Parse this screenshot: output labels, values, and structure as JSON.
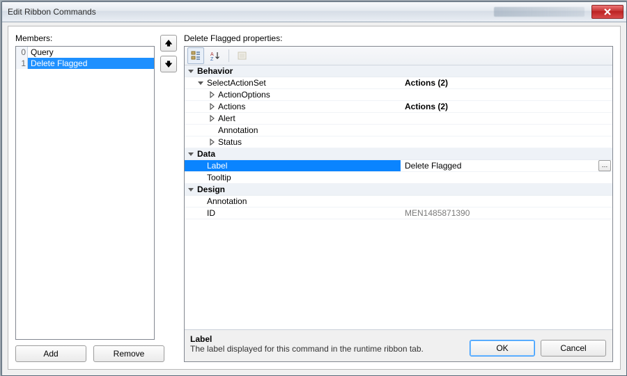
{
  "window": {
    "title": "Edit Ribbon Commands"
  },
  "colors": {
    "select": "#1e90ff",
    "prop_select": "#0a84ff"
  },
  "members": {
    "label": "Members:",
    "items": [
      {
        "index": "0",
        "name": "Query",
        "selected": false
      },
      {
        "index": "1",
        "name": "Delete Flagged",
        "selected": true
      }
    ],
    "add_label": "Add",
    "remove_label": "Remove"
  },
  "properties": {
    "heading": "Delete Flagged properties:",
    "toolbar_icons": [
      "categorized",
      "alphabetical",
      "property-pages"
    ],
    "categories": [
      {
        "name": "Behavior",
        "rows": [
          {
            "key": "SelectActionSet",
            "value": "Actions (2)",
            "indent": 1,
            "expander": "open"
          },
          {
            "key": "ActionOptions",
            "value": "",
            "indent": 2,
            "expander": "closed"
          },
          {
            "key": "Actions",
            "value": "Actions (2)",
            "indent": 2,
            "expander": "closed"
          },
          {
            "key": "Alert",
            "value": "",
            "indent": 2,
            "expander": "closed"
          },
          {
            "key": "Annotation",
            "value": "",
            "indent": 2,
            "expander": "none"
          },
          {
            "key": "Status",
            "value": "",
            "indent": 2,
            "expander": "closed"
          }
        ]
      },
      {
        "name": "Data",
        "rows": [
          {
            "key": "Label",
            "value": "Delete Flagged",
            "indent": 1,
            "selected": true,
            "ellipsis": true
          },
          {
            "key": "Tooltip",
            "value": "",
            "indent": 1
          }
        ]
      },
      {
        "name": "Design",
        "rows": [
          {
            "key": "Annotation",
            "value": "",
            "indent": 1
          },
          {
            "key": "ID",
            "value": "MEN1485871390",
            "indent": 1,
            "value_class": "id-value"
          }
        ]
      }
    ],
    "description": {
      "title": "Label",
      "text": "The label displayed for this command in the runtime ribbon tab."
    }
  },
  "dialog_buttons": {
    "ok": "OK",
    "cancel": "Cancel"
  }
}
